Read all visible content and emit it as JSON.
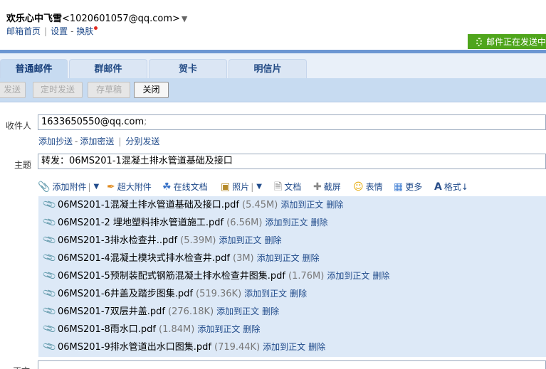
{
  "header": {
    "user_name": "欢乐心中飞雪",
    "user_email": "<1020601057@qq.com>",
    "caret": "▼",
    "links": [
      "邮箱首页",
      "设置",
      "换肤"
    ],
    "sending_status": "邮件正在发送中"
  },
  "tabs": [
    {
      "label": "普通邮件",
      "active": true
    },
    {
      "label": "群邮件",
      "active": false
    },
    {
      "label": "贺卡",
      "active": false
    },
    {
      "label": "明信片",
      "active": false
    }
  ],
  "toolbar": {
    "send": "发送",
    "scheduled_send": "定时发送",
    "save_draft": "存草稿",
    "close": "关闭"
  },
  "compose": {
    "to_label": "收件人",
    "to_value": "1633650550@qq.com",
    "to_suffix": ";",
    "cc_link": "添加抄送",
    "bcc_link": "添加密送",
    "separate_link": "分别发送",
    "subject_label": "主题",
    "subject_value": "转发：06MS201-1混凝土排水管道基础及接口",
    "body_label": "正文"
  },
  "attach_toolbar": {
    "add_attachment": "添加附件",
    "large_attachment": "超大附件",
    "online_doc": "在线文档",
    "photo": "照片",
    "document": "文档",
    "screenshot": "截屏",
    "emoji": "表情",
    "more": "更多",
    "format": "格式↓"
  },
  "attachment_actions": {
    "add_to_body": "添加到正文",
    "delete": "删除"
  },
  "attachments": [
    {
      "name": "06MS201-1混凝土排水管道基础及接口.pdf",
      "size": "(5.45M)"
    },
    {
      "name": "06MS201-2 埋地塑料排水管道施工.pdf",
      "size": "(6.56M)"
    },
    {
      "name": "06MS201-3排水检查井..pdf",
      "size": "(5.39M)"
    },
    {
      "name": "06MS201-4混凝土模块式排水检查井.pdf",
      "size": "(3M)"
    },
    {
      "name": "06MS201-5预制装配式钢筋混凝土排水检查井图集.pdf",
      "size": "(1.76M)"
    },
    {
      "name": "06MS201-6井盖及踏步图集.pdf",
      "size": "(519.36K)"
    },
    {
      "name": "06MS201-7双层井盖.pdf",
      "size": "(276.18K)"
    },
    {
      "name": "06MS201-8雨水口.pdf",
      "size": "(1.84M)"
    },
    {
      "name": "06MS201-9排水管道出水口图集.pdf",
      "size": "(719.44K)"
    }
  ],
  "colors": {
    "accent_blue": "#6c96d2",
    "tab_active": "#c7dbf1",
    "sending_green": "#4fa51c",
    "link_blue": "#1f4a8a",
    "attachment_bg": "#dde9f7"
  }
}
